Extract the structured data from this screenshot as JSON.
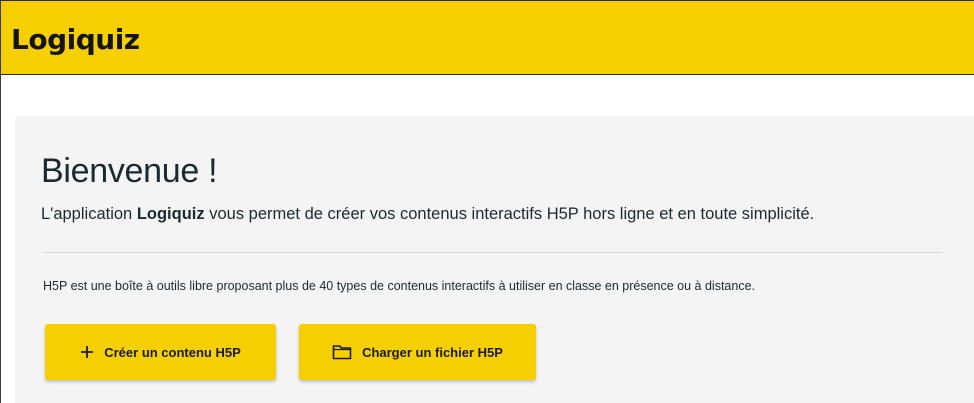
{
  "app": {
    "brand": "Logiquiz"
  },
  "main": {
    "title": "Bienvenue !",
    "intro_prefix": "L'application ",
    "intro_brand": "Logiquiz",
    "intro_suffix": " vous permet de créer vos contenus interactifs H5P hors ligne et en toute simplicité.",
    "description": "H5P est une boîte à outils libre proposant plus de 40 types de contenus interactifs à utiliser en classe en présence ou à distance."
  },
  "actions": {
    "create": {
      "label": "Créer un contenu H5P",
      "icon": "plus-icon"
    },
    "load": {
      "label": "Charger un fichier H5P",
      "icon": "folder-icon"
    }
  },
  "colors": {
    "accent": "#f5cf00",
    "panel": "#f4f4f4",
    "text": "#1b2a30"
  }
}
